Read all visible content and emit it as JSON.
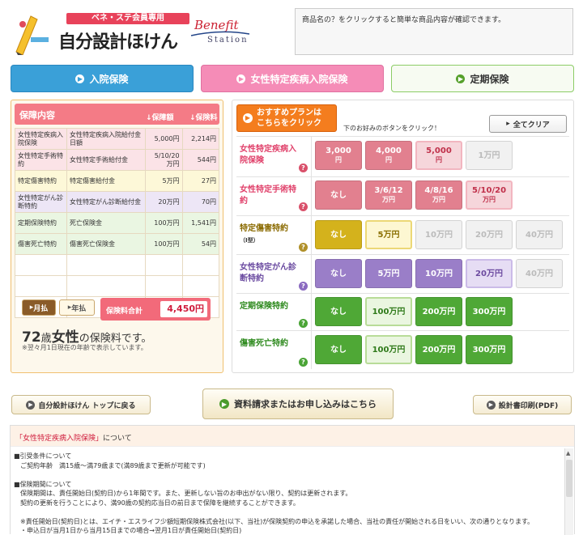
{
  "header": {
    "badge": "ベネ・ステ会員専用",
    "title": "自分設計ほけん",
    "benefit_line1": "Benefit",
    "benefit_line2": "Station",
    "info_text": "商品名の？をクリックすると簡単な商品内容が確認できます。"
  },
  "tabs": [
    {
      "label": "入院保険"
    },
    {
      "label": "女性特定疾病入院保険"
    },
    {
      "label": "定期保険"
    }
  ],
  "coverage": {
    "title": "保障内容",
    "col_amount": "↓保障額",
    "col_premium": "↓保険料",
    "rows": [
      {
        "name": "女性特定疾病入院保険",
        "desc": "女性特定疾病入院給付金日額",
        "amount": "5,000円",
        "premium": "2,214円",
        "bg": "#fbe3e7"
      },
      {
        "name": "女性特定手術特約",
        "desc": "女性特定手術給付金",
        "amount": "5/10/20万円",
        "premium": "544円",
        "bg": "#fbe3e7"
      },
      {
        "name": "特定傷害特約",
        "desc": "特定傷害給付金",
        "amount": "5万円",
        "premium": "27円",
        "bg": "#fdf8d8"
      },
      {
        "name": "女性特定がん診断特約",
        "desc": "女性特定がん診断給付金",
        "amount": "20万円",
        "premium": "70円",
        "bg": "#ede6f6"
      },
      {
        "name": "定期保険特約",
        "desc": "死亡保険金",
        "amount": "100万円",
        "premium": "1,541円",
        "bg": "#eaf6e2"
      },
      {
        "name": "傷害死亡特約",
        "desc": "傷害死亡保険金",
        "amount": "100万円",
        "premium": "54円",
        "bg": "#eaf6e2"
      },
      {
        "name": "",
        "desc": "",
        "amount": "",
        "premium": "",
        "bg": "#ffffff"
      },
      {
        "name": "",
        "desc": "",
        "amount": "",
        "premium": "",
        "bg": "#ffffff"
      },
      {
        "name": "",
        "desc": "",
        "amount": "",
        "premium": "",
        "bg": "#ffffff"
      }
    ],
    "toggle_monthly": "月払",
    "toggle_annual": "年払",
    "total_label": "保険料合計",
    "total_value": "4,450円",
    "age": "72",
    "age_suffix": "歳",
    "gender": "女性",
    "age_tail": "の保険料です。",
    "note": "※翌々月1日現在の年齢で表示しています。"
  },
  "plans": {
    "recommend_line1": "おすすめプランは",
    "recommend_line2": "こちらをクリック",
    "hint": "下のお好みのボタンをクリック！",
    "clear_label": "全てクリア",
    "rows": [
      {
        "label": "女性特定疾病入院保険",
        "sub": "",
        "color": "#e0406a",
        "qcolor": "#d9506a",
        "options": [
          {
            "v": "3,000",
            "u": "円",
            "style": "pk"
          },
          {
            "v": "4,000",
            "u": "円",
            "style": "pk"
          },
          {
            "v": "5,000",
            "u": "円",
            "style": "pkl"
          },
          {
            "v": "1万円",
            "u": "",
            "style": "pkd"
          }
        ]
      },
      {
        "label": "女性特定手術特約",
        "sub": "",
        "color": "#e0406a",
        "qcolor": "#d9506a",
        "options": [
          {
            "v": "なし",
            "u": "",
            "style": "pk"
          },
          {
            "v": "3/6/12",
            "u": "万円",
            "style": "pk"
          },
          {
            "v": "4/8/16",
            "u": "万円",
            "style": "pk"
          },
          {
            "v": "5/10/20",
            "u": "万円",
            "style": "pkl"
          }
        ]
      },
      {
        "label": "特定傷害特約",
        "sub": "（Ⅰ型）",
        "color": "#8a6a00",
        "qcolor": "#b0902a",
        "options": [
          {
            "v": "なし",
            "u": "",
            "style": "yl"
          },
          {
            "v": "5万円",
            "u": "",
            "style": "yll"
          },
          {
            "v": "10万円",
            "u": "",
            "style": "ygd"
          },
          {
            "v": "20万円",
            "u": "",
            "style": "ygd"
          },
          {
            "v": "40万円",
            "u": "",
            "style": "ygd"
          }
        ]
      },
      {
        "label": "女性特定がん診断特約",
        "sub": "",
        "color": "#6a4aa0",
        "qcolor": "#8a6ac0",
        "options": [
          {
            "v": "なし",
            "u": "",
            "style": "pu"
          },
          {
            "v": "5万円",
            "u": "",
            "style": "pu"
          },
          {
            "v": "10万円",
            "u": "",
            "style": "pu"
          },
          {
            "v": "20万円",
            "u": "",
            "style": "pul"
          },
          {
            "v": "40万円",
            "u": "",
            "style": "ygd"
          }
        ]
      },
      {
        "label": "定期保険特約",
        "sub": "",
        "color": "#2e8a1e",
        "qcolor": "#4aa436",
        "options": [
          {
            "v": "なし",
            "u": "",
            "style": "gr"
          },
          {
            "v": "100万円",
            "u": "",
            "style": "grl"
          },
          {
            "v": "200万円",
            "u": "",
            "style": "gr"
          },
          {
            "v": "300万円",
            "u": "",
            "style": "gr"
          }
        ]
      },
      {
        "label": "傷害死亡特約",
        "sub": "",
        "color": "#2e8a1e",
        "qcolor": "#4aa436",
        "options": [
          {
            "v": "なし",
            "u": "",
            "style": "gr"
          },
          {
            "v": "100万円",
            "u": "",
            "style": "grl"
          },
          {
            "v": "200万円",
            "u": "",
            "style": "gr"
          },
          {
            "v": "300万円",
            "u": "",
            "style": "gr"
          }
        ]
      }
    ]
  },
  "buttons": {
    "top": "自分設計ほけん トップに戻る",
    "apply": "資料請求またはお申し込みはこちら",
    "print": "設計書印刷(PDF)"
  },
  "detail": {
    "head_highlight": "「女性特定疾病入院保険」",
    "head_tail": "について",
    "lines": [
      "■引受条件について",
      "　ご契約年齢　満15歳～満79歳まで(満89歳まで更新が可能です)",
      "",
      "■保険期間について",
      "　保険期間は、責任開始日(契約日)から1年間です。また、更新しない旨のお申出がない限り、契約は更新されます。",
      "　契約の更新を行うことにより、満90歳の契約応当日の前日まで保障を継続することができます。",
      "",
      "　※責任開始日(契約日)とは、エイチ・エスライフ少額短期保険株式会社(以下、当社)が保険契約の申込を承諾した場合、当社の責任が開始される日をいい、次の通りとなります。",
      "　・申込日が当月1日から当月15日までの場合→翌月1日が責任開始日(契約日)"
    ]
  }
}
